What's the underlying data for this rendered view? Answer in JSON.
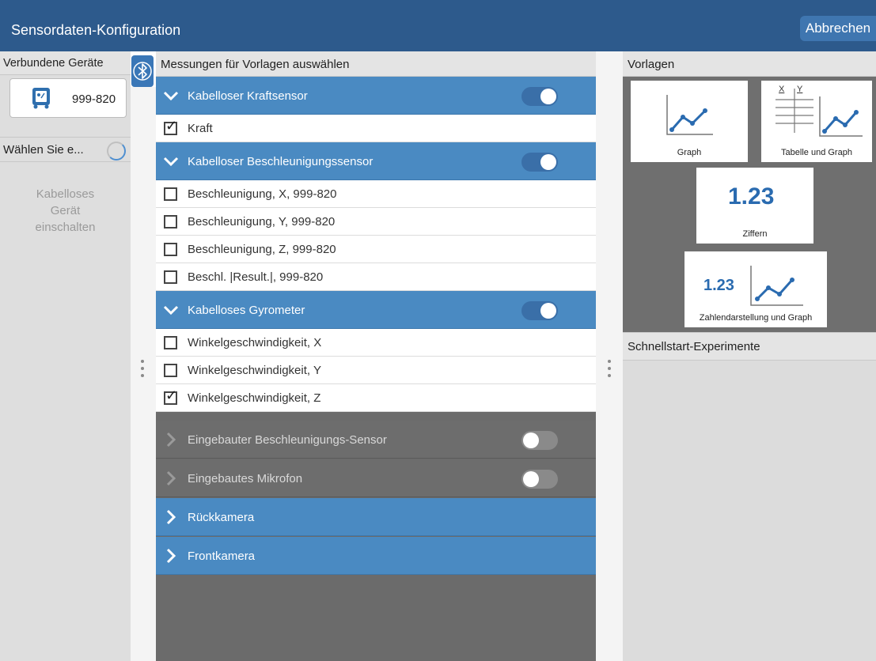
{
  "header": {
    "title": "Sensordaten-Konfiguration",
    "cancel_label": "Abbrechen"
  },
  "left": {
    "header": "Verbundene Geräte",
    "device_label": "999-820",
    "choose_label": "Wählen Sie e...",
    "info_line1": "Kabelloses",
    "info_line2": "Gerät",
    "info_line3": "einschalten"
  },
  "middle": {
    "header": "Messungen für Vorlagen auswählen",
    "sections": [
      {
        "label": "Kabelloser Kraftsensor",
        "expanded": true,
        "enabled": true,
        "items": [
          {
            "label": "Kraft",
            "checked": true
          }
        ]
      },
      {
        "label": "Kabelloser Beschleunigungssensor",
        "expanded": true,
        "enabled": true,
        "items": [
          {
            "label": "Beschleunigung, X, 999-820",
            "checked": false
          },
          {
            "label": "Beschleunigung, Y, 999-820",
            "checked": false
          },
          {
            "label": "Beschleunigung, Z, 999-820",
            "checked": false
          },
          {
            "label": "Beschl. |Result.|, 999-820",
            "checked": false
          }
        ]
      },
      {
        "label": "Kabelloses Gyrometer",
        "expanded": true,
        "enabled": true,
        "items": [
          {
            "label": "Winkelgeschwindigkeit, X",
            "checked": false
          },
          {
            "label": "Winkelgeschwindigkeit, Y",
            "checked": false
          },
          {
            "label": "Winkelgeschwindigkeit, Z",
            "checked": true
          }
        ]
      },
      {
        "label": "Eingebauter Beschleunigungs-Sensor",
        "expanded": false,
        "enabled": false
      },
      {
        "label": "Eingebautes Mikrofon",
        "expanded": false,
        "enabled": false
      },
      {
        "label": "Rückkamera",
        "expanded": false
      },
      {
        "label": "Frontkamera",
        "expanded": false
      }
    ]
  },
  "right": {
    "header": "Vorlagen",
    "templates": [
      {
        "label": "Graph"
      },
      {
        "label": "Tabelle und Graph",
        "table_x": "X",
        "table_y": "Y"
      },
      {
        "label": "Ziffern",
        "number": "1.23"
      },
      {
        "label": "Zahlendarstellung und Graph",
        "number": "1.23"
      }
    ],
    "quick_header": "Schnellstart-Experimente"
  },
  "colors": {
    "topbar": "#2d5a8c",
    "section_blue": "#4a8ac2",
    "section_gray": "#6d6d6d",
    "toggle_on": "#3a6fa8",
    "accent_number": "#2a6bb0"
  }
}
